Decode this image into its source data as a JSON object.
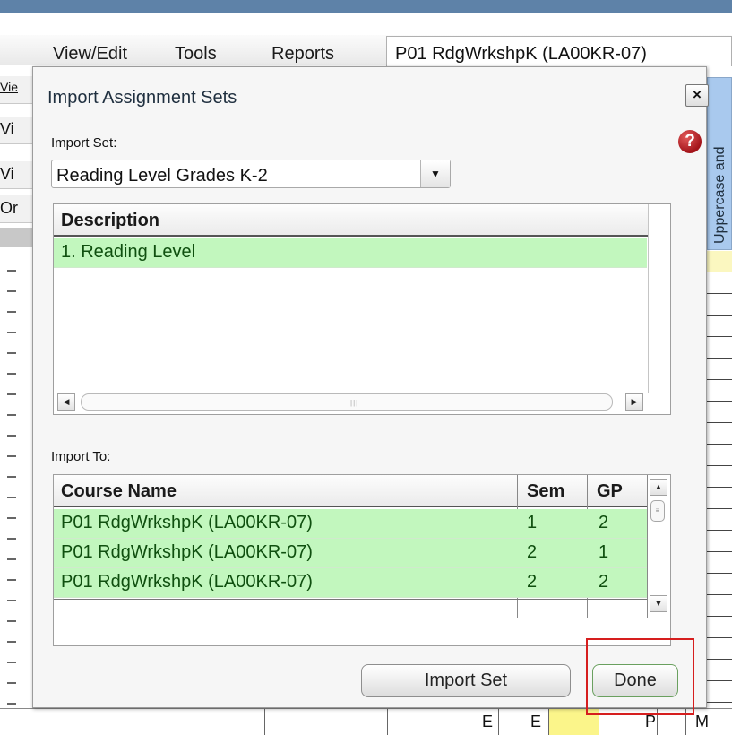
{
  "menu": {
    "items": [
      "View/Edit",
      "Tools",
      "Reports"
    ],
    "course_tab": "P01  RdgWrkshpK (LA00KR-07)"
  },
  "background": {
    "left_rows": [
      "Vie",
      "Vi",
      "Vi",
      "Or"
    ],
    "right_header": "Uppercase and",
    "bottom_row": {
      "cells": [
        "E",
        "E",
        "P",
        "M"
      ]
    },
    "colors": {
      "topbar": "#5e82a8",
      "header_blue": "#a9c9ee",
      "yellow": "#fbf58a"
    }
  },
  "dialog": {
    "title": "Import Assignment Sets",
    "close_label": "×",
    "import_set_label": "Import Set:",
    "help_label": "?",
    "import_set_value": "Reading Level Grades K-2",
    "description_grid": {
      "header": "Description",
      "rows": [
        "1. Reading Level"
      ]
    },
    "import_to_label": "Import To:",
    "courses_grid": {
      "headers": {
        "course": "Course Name",
        "sem": "Sem",
        "gp": "GP"
      },
      "rows": [
        {
          "course": "P01  RdgWrkshpK (LA00KR-07)",
          "sem": "1",
          "gp": "2"
        },
        {
          "course": "P01  RdgWrkshpK (LA00KR-07)",
          "sem": "2",
          "gp": "1"
        },
        {
          "course": "P01  RdgWrkshpK (LA00KR-07)",
          "sem": "2",
          "gp": "2"
        }
      ]
    },
    "buttons": {
      "import_set": "Import Set",
      "done": "Done"
    },
    "colors": {
      "row_green": "#c2f7be",
      "highlight": "#d61e1e",
      "help_red": "#c0272d"
    }
  }
}
